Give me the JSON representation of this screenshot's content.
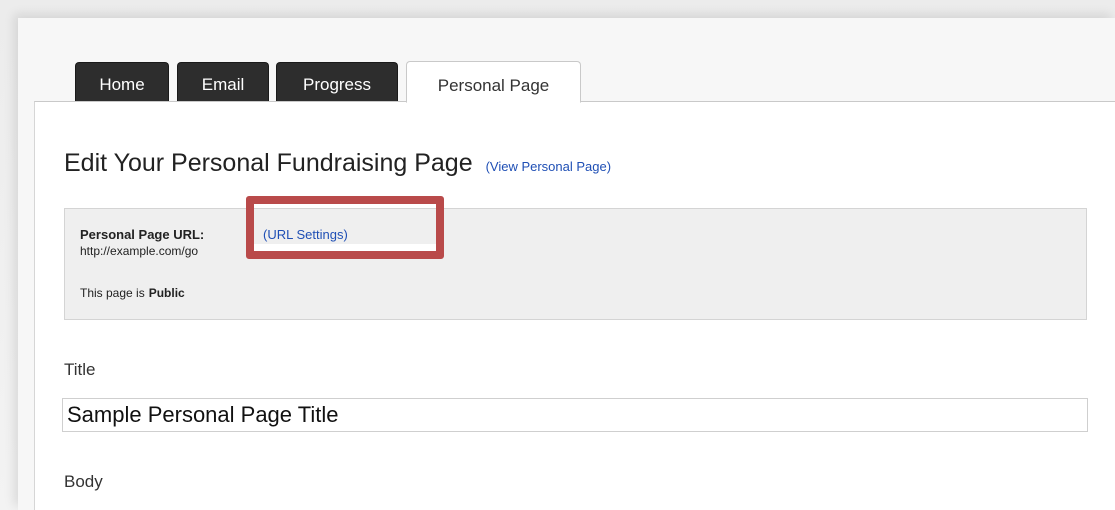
{
  "tabs": [
    {
      "label": "Home",
      "active": false
    },
    {
      "label": "Email",
      "active": false
    },
    {
      "label": "Progress",
      "active": false
    },
    {
      "label": "Personal Page",
      "active": true
    }
  ],
  "page": {
    "heading": "Edit Your Personal Fundraising Page",
    "view_link": "(View Personal Page)"
  },
  "info": {
    "url_label": "Personal Page URL:",
    "url_settings_link": "(URL Settings)",
    "url_value": "http://example.com/go",
    "visibility_prefix": "This page is",
    "visibility_value": "Public"
  },
  "form": {
    "title_label": "Title",
    "title_value": "Sample Personal Page Title",
    "body_label": "Body"
  },
  "colors": {
    "highlight": "#b94a4a",
    "link": "#1f4fb5",
    "tab_dark": "#2d2d2d"
  }
}
